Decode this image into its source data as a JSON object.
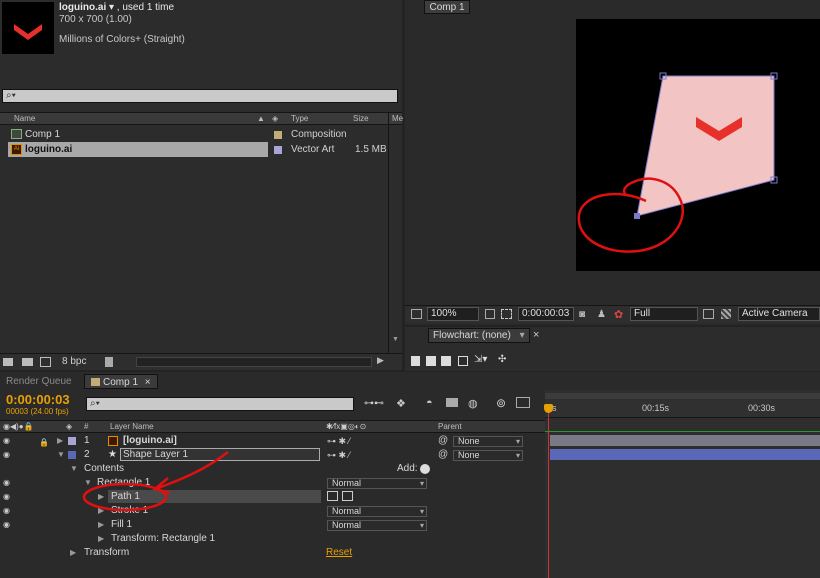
{
  "project": {
    "file_name": "loguino.ai",
    "used_suffix": " ▾ , used 1 time",
    "dimensions": "700 x 700 (1.00)",
    "colors": "Millions of Colors+ (Straight)",
    "search_placeholder": "",
    "columns": {
      "name": "Name",
      "type": "Type",
      "size": "Size",
      "media": "Me"
    },
    "items": [
      {
        "name": "Comp 1",
        "type": "Composition",
        "size": "",
        "swatch": "#c2ad77",
        "icon": "composition-icon"
      },
      {
        "name": "loguino.ai",
        "type": "Vector Art",
        "size": "1.5 MB",
        "swatch": "#a8a4d4",
        "icon": "illustrator-file-icon"
      }
    ],
    "bpc": "8 bpc"
  },
  "viewer": {
    "tab": "Comp 1",
    "zoom": "100%",
    "timecode": "0:00:00:03",
    "resolution": "Full",
    "camera": "Active Camera"
  },
  "flowchart": {
    "tab": "Flowchart: (none)",
    "close": "×"
  },
  "timeline": {
    "tabs": [
      {
        "label": "Render Queue"
      },
      {
        "label": "Comp 1",
        "close": "×"
      }
    ],
    "timecode": "0:00:00:03",
    "frames": "00003 (24.00 fps)",
    "columns": {
      "num": "#",
      "layer_name": "Layer Name",
      "parent": "Parent"
    },
    "layers": [
      {
        "num": "1",
        "name": "[loguino.ai]",
        "parent": "None"
      },
      {
        "num": "2",
        "name": "Shape Layer 1",
        "parent": "None"
      }
    ],
    "contents": "Contents",
    "add_label": "Add:",
    "rectangle": "Rectangle 1",
    "rectangle_mode": "Normal",
    "path": "Path 1",
    "stroke": "Stroke 1",
    "stroke_mode": "Normal",
    "fill": "Fill 1",
    "fill_mode": "Normal",
    "transform_rect": "Transform: Rectangle 1",
    "transform": "Transform",
    "reset": "Reset",
    "ruler": [
      "0s",
      "00:15s",
      "00:30s"
    ]
  },
  "colors": {
    "accent_orange": "#e8a000",
    "annotation_red": "#e01010",
    "shape_fill": "#f2c4c4",
    "logo_red": "#e8302a",
    "shape_layer_bar": "#5a68b8",
    "ai_layer_bar": "#7a7a86"
  }
}
